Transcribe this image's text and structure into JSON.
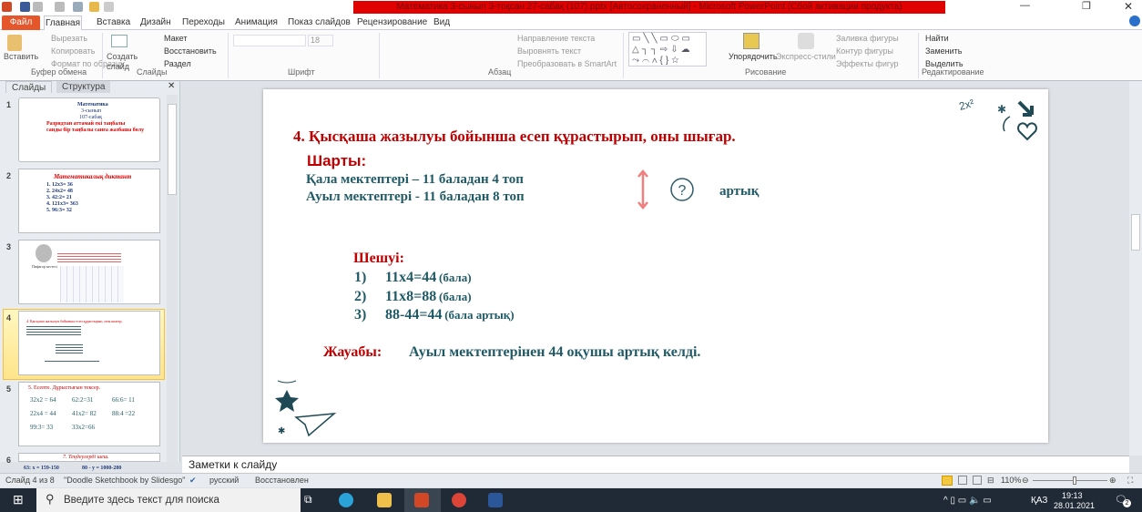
{
  "window": {
    "title": "Математика 3-сынып 3-тоқсан 27-сабақ (107).pptx [Автосохраненный]  -  Microsoft PowerPoint (Сбой активации продукта)",
    "minimize": "—",
    "restore": "❐",
    "close": "✕"
  },
  "tabs": [
    "Файл",
    "Главная",
    "Вставка",
    "Дизайн",
    "Переходы",
    "Анимация",
    "Показ слайдов",
    "Рецензирование",
    "Вид"
  ],
  "ribbon": {
    "clipboard": {
      "paste": "Вставить",
      "cut": "Вырезать",
      "copy": "Копировать",
      "format": "Формат по образцу",
      "group": "Буфер обмена"
    },
    "slides": {
      "new": "Создать слайд",
      "layout": "Макет",
      "reset": "Восстановить",
      "section": "Раздел",
      "group": "Слайды"
    },
    "font": {
      "size": "18",
      "group": "Шрифт"
    },
    "paragraph": {
      "direction": "Направление текста",
      "align": "Выровнять текст",
      "smartart": "Преобразовать в SmartArt",
      "group": "Абзац"
    },
    "drawing": {
      "arrange": "Упорядочить",
      "styles": "Экспресс-стили",
      "fill": "Заливка фигуры",
      "outline": "Контур фигуры",
      "effects": "Эффекты фигур",
      "group": "Рисование"
    },
    "editing": {
      "find": "Найти",
      "replace": "Заменить",
      "select": "Выделить",
      "group": "Редактирование"
    }
  },
  "panel": {
    "tab_slides": "Слайды",
    "tab_outline": "Структура",
    "close": "✕"
  },
  "thumbs": [
    {
      "num": "1",
      "lines": [
        "Математика",
        "3-сынып",
        "107-сабақ",
        "Разрядтан аттамай екі таңбалы",
        "санды бір таңбалы санға жазбаша бөлу"
      ]
    },
    {
      "num": "2",
      "lines": [
        "Математикалық диктант",
        "1. 12x3= 36",
        "2. 24x2= 48",
        "3. 42:2= 21",
        "4. 121x3= 363",
        "5. 96:3= 32"
      ]
    },
    {
      "num": "3",
      "lines": [
        "Пифагор кестесі"
      ]
    },
    {
      "num": "4",
      "lines": [
        "4. Қысқаша жазылуы бойынша есеп құрастырып, оны шығар."
      ]
    },
    {
      "num": "5",
      "lines": [
        "5. Есепте. Дұрыстығын тексер.",
        "32x2 = 64",
        "62:2=31",
        "66:6= 11",
        "22x4 = 44",
        "41x2= 82",
        "88:4 =22",
        "99:3= 33",
        "33x2=66"
      ]
    },
    {
      "num": "6",
      "lines": [
        "7. Теңдеулерді шеш.",
        "63: x = 159-150",
        "80 - y = 1000-280"
      ]
    }
  ],
  "slide": {
    "title": "4. Қысқаша жазылуы бойынша есеп құрастырып, оны шығар.",
    "condition_label": "Шарты:",
    "condition_lines": [
      "Қала мектептері – 11 баладан 4 топ",
      "Ауыл мектептері  - 11 баладан 8 топ"
    ],
    "more_label": "артық",
    "solution_label": "Шешуі:",
    "steps": [
      {
        "n": "1)",
        "expr": "11x4=44",
        "unit": "(бала)"
      },
      {
        "n": "2)",
        "expr": "11x8=88",
        "unit": "(бала)"
      },
      {
        "n": "3)",
        "expr": "88-44=44",
        "unit": "(бала  артық)"
      }
    ],
    "answer_label": "Жауабы:",
    "answer_text": "Ауыл мектептерінен 44 оқушы артық келді.",
    "doodle": "2x²"
  },
  "notes_placeholder": "Заметки к слайду",
  "status": {
    "slide": "Слайд 4 из 8",
    "theme": "\"Doodle Sketchbook by Slidesgo\"",
    "lang": "русский",
    "state": "Восстановлен",
    "zoom": "110%"
  },
  "taskbar": {
    "search": "Введите здесь текст для поиска",
    "lang": "ҚАЗ",
    "time": "19:13",
    "date": "28.01.2021",
    "notif": "2"
  }
}
